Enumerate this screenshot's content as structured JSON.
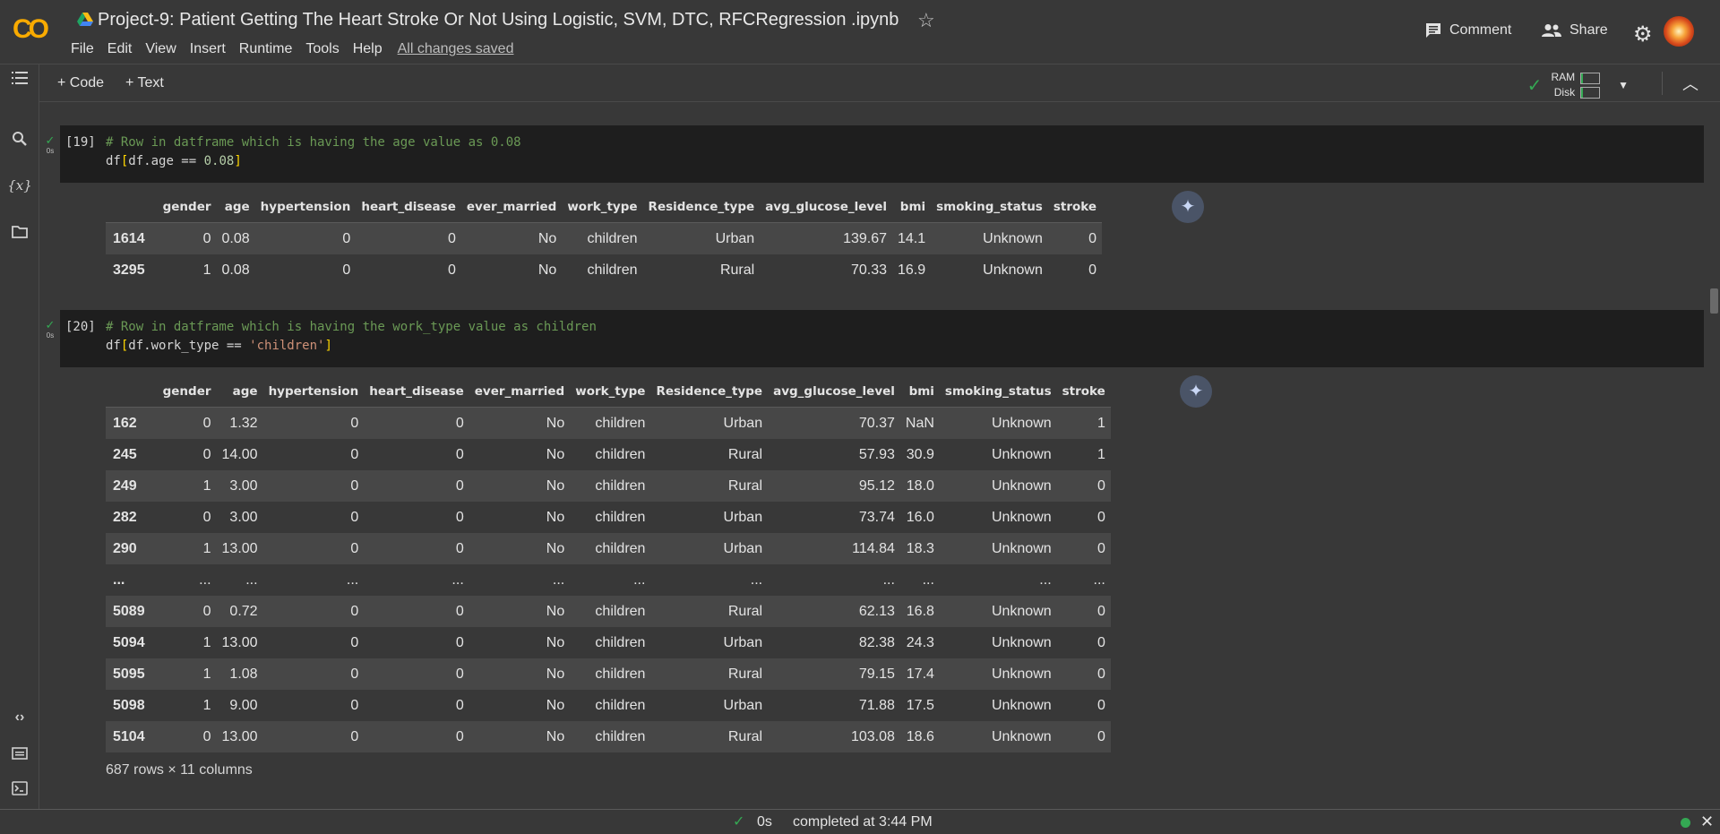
{
  "header": {
    "logo": "CO",
    "title": "Project-9: Patient Getting The Heart Stroke Or Not Using Logistic,  SVM, DTC, RFCRegression .ipynb",
    "menu": [
      "File",
      "Edit",
      "View",
      "Insert",
      "Runtime",
      "Tools",
      "Help"
    ],
    "save_status": "All changes saved",
    "comment_label": "Comment",
    "share_label": "Share"
  },
  "toolbar": {
    "add_code": "+ Code",
    "add_text": "+ Text",
    "ram_label": "RAM",
    "disk_label": "Disk",
    "ram_fraction": 0.1,
    "disk_fraction": 0.1
  },
  "sidebar": {
    "top_icons": [
      "table-of-contents-icon",
      "search-icon",
      "variables-icon",
      "files-icon"
    ],
    "bottom_icons": [
      "code-snippets-icon",
      "command-palette-icon",
      "terminal-icon"
    ]
  },
  "cells": [
    {
      "exec_count": "[19]",
      "exec_time": "0s",
      "comment": "# Row in datframe which is having the age value as 0.08",
      "code_prefix": "df",
      "code_open": "[",
      "code_mid": "df.age == ",
      "code_value": "0.08",
      "code_close": "]",
      "value_kind": "num",
      "output": {
        "columns": [
          "",
          "gender",
          "age",
          "hypertension",
          "heart_disease",
          "ever_married",
          "work_type",
          "Residence_type",
          "avg_glucose_level",
          "bmi",
          "smoking_status",
          "stroke"
        ],
        "rows": [
          [
            "1614",
            "0",
            "0.08",
            "0",
            "0",
            "No",
            "children",
            "Urban",
            "139.67",
            "14.1",
            "Unknown",
            "0"
          ],
          [
            "3295",
            "1",
            "0.08",
            "0",
            "0",
            "No",
            "children",
            "Rural",
            "70.33",
            "16.9",
            "Unknown",
            "0"
          ]
        ]
      }
    },
    {
      "exec_count": "[20]",
      "exec_time": "0s",
      "comment": "# Row in datframe which is having the work_type value as children",
      "code_prefix": "df",
      "code_open": "[",
      "code_mid": "df.work_type == ",
      "code_value": "'children'",
      "code_close": "]",
      "value_kind": "str",
      "output": {
        "columns": [
          "",
          "gender",
          "age",
          "hypertension",
          "heart_disease",
          "ever_married",
          "work_type",
          "Residence_type",
          "avg_glucose_level",
          "bmi",
          "smoking_status",
          "stroke"
        ],
        "rows": [
          [
            "162",
            "0",
            "1.32",
            "0",
            "0",
            "No",
            "children",
            "Urban",
            "70.37",
            "NaN",
            "Unknown",
            "1"
          ],
          [
            "245",
            "0",
            "14.00",
            "0",
            "0",
            "No",
            "children",
            "Rural",
            "57.93",
            "30.9",
            "Unknown",
            "1"
          ],
          [
            "249",
            "1",
            "3.00",
            "0",
            "0",
            "No",
            "children",
            "Rural",
            "95.12",
            "18.0",
            "Unknown",
            "0"
          ],
          [
            "282",
            "0",
            "3.00",
            "0",
            "0",
            "No",
            "children",
            "Urban",
            "73.74",
            "16.0",
            "Unknown",
            "0"
          ],
          [
            "290",
            "1",
            "13.00",
            "0",
            "0",
            "No",
            "children",
            "Urban",
            "114.84",
            "18.3",
            "Unknown",
            "0"
          ],
          [
            "...",
            "...",
            "...",
            "...",
            "...",
            "...",
            "...",
            "...",
            "...",
            "...",
            "...",
            "..."
          ],
          [
            "5089",
            "0",
            "0.72",
            "0",
            "0",
            "No",
            "children",
            "Rural",
            "62.13",
            "16.8",
            "Unknown",
            "0"
          ],
          [
            "5094",
            "1",
            "13.00",
            "0",
            "0",
            "No",
            "children",
            "Urban",
            "82.38",
            "24.3",
            "Unknown",
            "0"
          ],
          [
            "5095",
            "1",
            "1.08",
            "0",
            "0",
            "No",
            "children",
            "Rural",
            "79.15",
            "17.4",
            "Unknown",
            "0"
          ],
          [
            "5098",
            "1",
            "9.00",
            "0",
            "0",
            "No",
            "children",
            "Urban",
            "71.88",
            "17.5",
            "Unknown",
            "0"
          ],
          [
            "5104",
            "0",
            "13.00",
            "0",
            "0",
            "No",
            "children",
            "Rural",
            "103.08",
            "18.6",
            "Unknown",
            "0"
          ]
        ],
        "shape": "687 rows × 11 columns"
      }
    }
  ],
  "status": {
    "duration": "0s",
    "message": "completed at 3:44 PM"
  }
}
